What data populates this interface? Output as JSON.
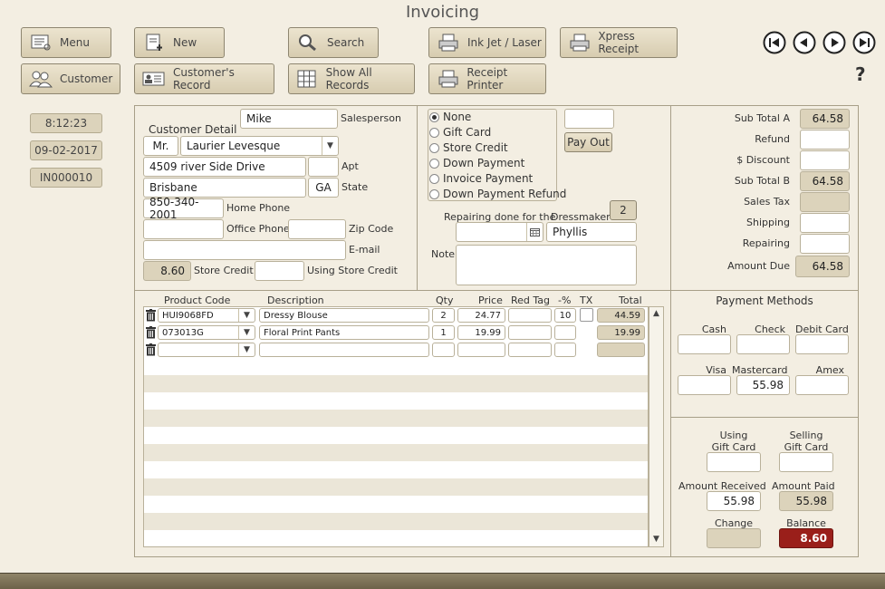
{
  "title": "Invoicing",
  "toolbar": {
    "menu": "Menu",
    "new": "New",
    "search": "Search",
    "inkjet": "Ink Jet / Laser",
    "xpress": "Xpress Receipt",
    "customer": "Customer",
    "customer_record": "Customer's Record",
    "show_all": "Show All Records",
    "receipt_printer": "Receipt Printer"
  },
  "help": "?",
  "info": {
    "time": "8:12:23",
    "date": "09-02-2017",
    "invoice": "IN000010"
  },
  "customer": {
    "salesperson_value": "Mike",
    "salesperson_label": "Salesperson",
    "detail_label": "Customer Detail",
    "title": "Mr.",
    "name": "Laurier Levesque",
    "address": "4509 river Side Drive",
    "apt_label": "Apt",
    "apt": "",
    "city": "Brisbane",
    "state": "GA",
    "state_label": "State",
    "home_phone": "850-340-2001",
    "home_phone_label": "Home Phone",
    "office_phone": "",
    "office_phone_label": "Office Phone",
    "zip": "",
    "zip_label": "Zip Code",
    "email": "",
    "email_label": "E-mail",
    "store_credit": "8.60",
    "store_credit_label": "Store Credit",
    "using_store_credit": "",
    "using_store_credit_label": "Using Store Credit"
  },
  "payment_type": {
    "options": [
      "None",
      "Gift Card",
      "Store Credit",
      "Down Payment",
      "Invoice Payment",
      "Down Payment Refund"
    ],
    "selected": "None",
    "amount": "",
    "pay_out": "Pay Out"
  },
  "repair": {
    "label": "Repairing done for the",
    "date": "",
    "dressmaker_label": "Dressmaker",
    "dressmaker_count": "2",
    "dressmaker": "Phyllis",
    "note_label": "Note",
    "note": ""
  },
  "totals": {
    "subtotal_a_label": "Sub Total A",
    "subtotal_a": "64.58",
    "refund_label": "Refund",
    "refund": "",
    "discount_label": "$ Discount",
    "discount": "",
    "subtotal_b_label": "Sub Total B",
    "subtotal_b": "64.58",
    "sales_tax_label": "Sales Tax",
    "sales_tax": "",
    "shipping_label": "Shipping",
    "shipping": "",
    "repairing_label": "Repairing",
    "repairing": "",
    "amount_due_label": "Amount Due",
    "amount_due": "64.58"
  },
  "items": {
    "headers": {
      "code": "Product Code",
      "desc": "Description",
      "qty": "Qty",
      "price": "Price",
      "red_tag": "Red Tag",
      "pct": "-%",
      "tx": "TX",
      "total": "Total"
    },
    "rows": [
      {
        "code": "HUI9068FD",
        "desc": "Dressy Blouse",
        "qty": "2",
        "price": "24.77",
        "red_tag": "",
        "pct": "10",
        "total": "44.59"
      },
      {
        "code": "073013G",
        "desc": "Floral Print Pants",
        "qty": "1",
        "price": "19.99",
        "red_tag": "",
        "pct": "",
        "total": "19.99"
      },
      {
        "code": "",
        "desc": "",
        "qty": "",
        "price": "",
        "red_tag": "",
        "pct": "",
        "total": ""
      }
    ]
  },
  "payment_methods": {
    "title": "Payment Methods",
    "cash_label": "Cash",
    "cash": "",
    "check_label": "Check",
    "check": "",
    "debit_label": "Debit Card",
    "debit": "",
    "visa_label": "Visa",
    "visa": "",
    "mastercard_label": "Mastercard",
    "mastercard": "55.98",
    "amex_label": "Amex",
    "amex": ""
  },
  "summary": {
    "using_gc_label1": "Using",
    "using_gc_label2": "Gift Card",
    "using_gc": "",
    "selling_gc_label1": "Selling",
    "selling_gc_label2": "Gift Card",
    "selling_gc": "",
    "amount_received_label": "Amount Received",
    "amount_received": "55.98",
    "amount_paid_label": "Amount Paid",
    "amount_paid": "55.98",
    "change_label": "Change",
    "change": "",
    "balance_label": "Balance",
    "balance": "8.60"
  },
  "colors": {
    "balance": "#9a1f1a",
    "background": "#f3eee2"
  }
}
